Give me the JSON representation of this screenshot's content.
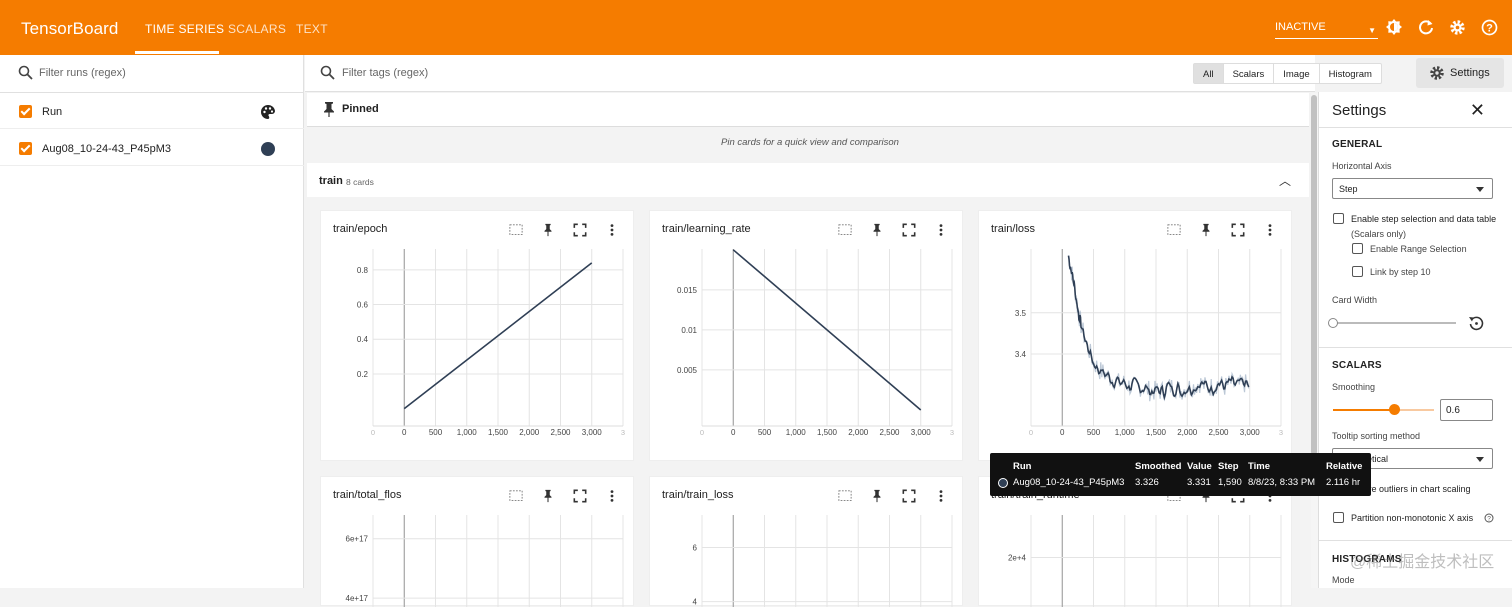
{
  "app": {
    "title": "TensorBoard",
    "tabs": [
      "TIME SERIES",
      "SCALARS",
      "TEXT"
    ],
    "status": "INACTIVE"
  },
  "runs": {
    "filter_placeholder": "Filter runs (regex)",
    "items": [
      {
        "label": "Run"
      },
      {
        "label": "Aug08_10-24-43_P45pM3"
      }
    ]
  },
  "toolbar": {
    "filter_placeholder": "Filter tags (regex)",
    "filters": [
      "All",
      "Scalars",
      "Image",
      "Histogram"
    ],
    "settings_label": "Settings"
  },
  "pinned": {
    "title": "Pinned",
    "message": "Pin cards for a quick view and comparison"
  },
  "group": {
    "name": "train",
    "count": "8 cards"
  },
  "cards": [
    {
      "title": "train/epoch"
    },
    {
      "title": "train/learning_rate"
    },
    {
      "title": "train/loss"
    },
    {
      "title": "train/total_flos"
    },
    {
      "title": "train/train_loss"
    },
    {
      "title": "train/train_runtime"
    }
  ],
  "chart_data": [
    {
      "type": "line",
      "title": "train/epoch",
      "x": [
        0,
        3000
      ],
      "y": [
        0,
        0.84
      ],
      "x_ticks": [
        "0",
        "500",
        "1,000",
        "1,500",
        "2,000",
        "2,500",
        "3,000"
      ],
      "y_ticks": [
        "0.2",
        "0.4",
        "0.6",
        "0.8"
      ]
    },
    {
      "type": "line",
      "title": "train/learning_rate",
      "x": [
        0,
        3000
      ],
      "y": [
        0.02,
        0
      ],
      "x_ticks": [
        "0",
        "500",
        "1,000",
        "1,500",
        "2,000",
        "2,500",
        "3,000"
      ],
      "y_ticks": [
        "0.005",
        "0.01",
        "0.015"
      ]
    },
    {
      "type": "line",
      "title": "train/loss",
      "x": [
        100,
        150,
        200,
        250,
        300,
        400,
        500,
        600,
        700,
        800,
        900,
        1000,
        1100,
        1200,
        1300,
        1400,
        1500,
        1600,
        1700,
        1800,
        1900,
        2000,
        2100,
        2200,
        2300,
        2400,
        2500,
        2600,
        2700,
        2800,
        2900,
        3000
      ],
      "y": [
        3.64,
        3.6,
        3.56,
        3.51,
        3.47,
        3.42,
        3.38,
        3.36,
        3.35,
        3.34,
        3.33,
        3.33,
        3.32,
        3.32,
        3.32,
        3.31,
        3.31,
        3.31,
        3.32,
        3.32,
        3.31,
        3.32,
        3.32,
        3.33,
        3.32,
        3.32,
        3.33,
        3.32,
        3.33,
        3.32,
        3.33,
        3.32
      ],
      "x_ticks": [
        "0",
        "500",
        "1,000",
        "1,500",
        "2,000",
        "2,500",
        "3,000"
      ],
      "y_ticks": [
        "3.4",
        "3.5"
      ]
    },
    {
      "type": "line",
      "title": "train/total_flos",
      "y_ticks": [
        "4e+17",
        "6e+17"
      ]
    },
    {
      "type": "line",
      "title": "train/train_loss",
      "y_ticks": [
        "4",
        "6"
      ]
    },
    {
      "type": "line",
      "title": "train/train_runtime",
      "y_ticks": [
        "2e+4"
      ]
    }
  ],
  "settings": {
    "title": "Settings",
    "general": "GENERAL",
    "horizontal_axis_label": "Horizontal Axis",
    "horizontal_axis": "Step",
    "enable_step": "Enable step selection and data table",
    "scalars_only": "(Scalars only)",
    "enable_range": "Enable Range Selection",
    "link_step": "Link by step 10",
    "card_width": "Card Width",
    "scalars": "SCALARS",
    "smoothing_label": "Smoothing",
    "smoothing": 0.6,
    "smoothing_text": "0.6",
    "tooltip_sort_label": "Tooltip sorting method",
    "tooltip_sort": "Alphabetical",
    "ignore_outliers": "Ignore outliers in chart scaling",
    "partition": "Partition non-monotonic X axis",
    "histograms": "HISTOGRAMS",
    "mode": "Mode"
  },
  "tooltip": {
    "headers": [
      "Run",
      "Smoothed",
      "Value",
      "Step",
      "Time",
      "Relative"
    ],
    "values": [
      "Aug08_10-24-43_P45pM3",
      "3.326",
      "3.331",
      "1,590",
      "8/8/23, 8:33 PM",
      "2.116 hr"
    ]
  },
  "watermark": "@稀土掘金技术社区",
  "colors": {
    "brand": "#f57c00",
    "series": "#2f3f55"
  }
}
